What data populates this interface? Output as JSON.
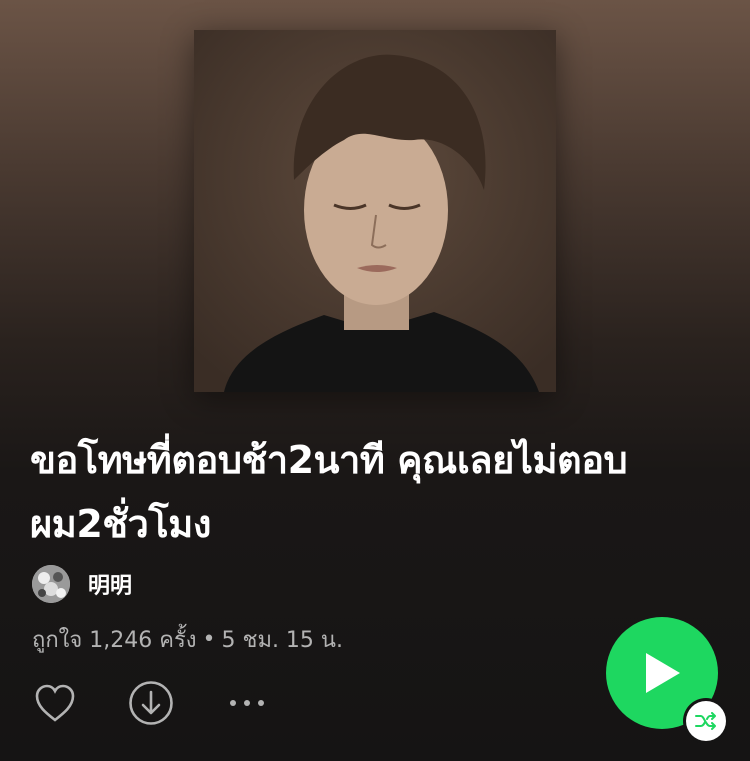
{
  "playlist": {
    "title": "ขอโทษที่ตอบช้า2นาที คุณเลยไม่ตอบผม2ชั่วโมง",
    "owner": "明明",
    "likes_text": "ถูกใจ 1,246 ครั้ง",
    "separator": "•",
    "duration": "5 ชม. 15 น."
  },
  "icons": {
    "like": "heart-icon",
    "download": "download-icon",
    "more": "more-icon",
    "play": "play-icon",
    "shuffle": "shuffle-icon"
  },
  "colors": {
    "accent": "#1ed760",
    "text_secondary": "#b3b3b3",
    "background_top": "#6b5446",
    "background_bottom": "#151414"
  }
}
